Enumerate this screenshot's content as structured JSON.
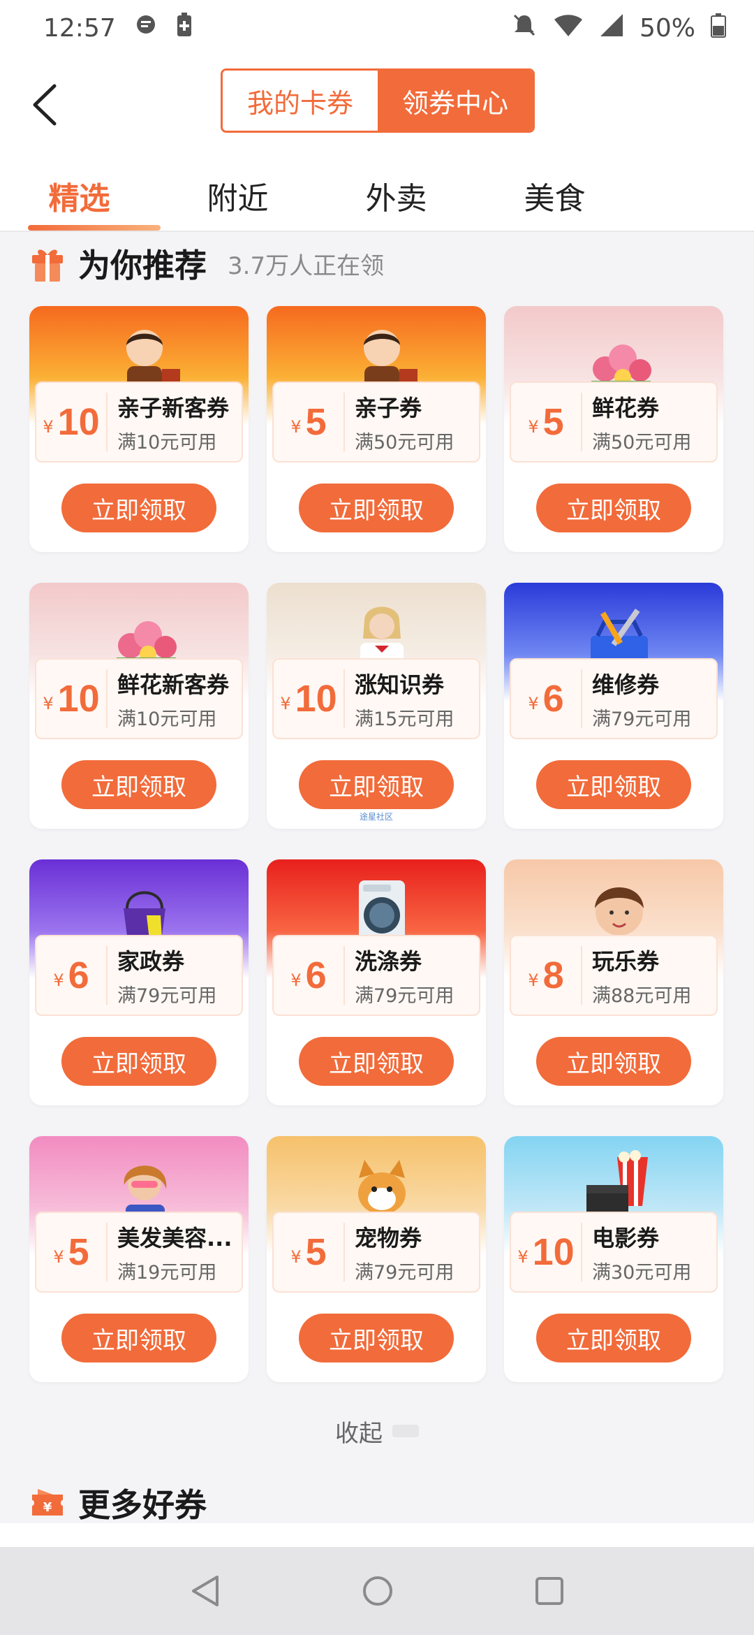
{
  "status_bar": {
    "time": "12:57",
    "battery": "50%"
  },
  "header": {
    "segments": [
      {
        "label": "我的卡券",
        "active": false
      },
      {
        "label": "领券中心",
        "active": true
      }
    ],
    "tabs": [
      {
        "label": "精选",
        "active": true
      },
      {
        "label": "附近",
        "active": false
      },
      {
        "label": "外卖",
        "active": false
      },
      {
        "label": "美食",
        "active": false
      }
    ]
  },
  "recommend": {
    "title": "为你推荐",
    "subtitle": "3.7万人正在领"
  },
  "coupons": [
    {
      "amount": "10",
      "name": "亲子新客券",
      "condition": "满10元可用",
      "button": "立即领取",
      "theme": "kids"
    },
    {
      "amount": "5",
      "name": "亲子券",
      "condition": "满50元可用",
      "button": "立即领取",
      "theme": "kids"
    },
    {
      "amount": "5",
      "name": "鲜花券",
      "condition": "满50元可用",
      "button": "立即领取",
      "theme": "flowers"
    },
    {
      "amount": "10",
      "name": "鲜花新客券",
      "condition": "满10元可用",
      "button": "立即领取",
      "theme": "flowers"
    },
    {
      "amount": "10",
      "name": "涨知识券",
      "condition": "满15元可用",
      "button": "立即领取",
      "theme": "study"
    },
    {
      "amount": "6",
      "name": "维修券",
      "condition": "满79元可用",
      "button": "立即领取",
      "theme": "repair"
    },
    {
      "amount": "6",
      "name": "家政券",
      "condition": "满79元可用",
      "button": "立即领取",
      "theme": "house"
    },
    {
      "amount": "6",
      "name": "洗涤券",
      "condition": "满79元可用",
      "button": "立即领取",
      "theme": "laundry"
    },
    {
      "amount": "8",
      "name": "玩乐券",
      "condition": "满88元可用",
      "button": "立即领取",
      "theme": "fun"
    },
    {
      "amount": "5",
      "name": "美发美容...",
      "condition": "满19元可用",
      "button": "立即领取",
      "theme": "beauty"
    },
    {
      "amount": "5",
      "name": "宠物券",
      "condition": "满79元可用",
      "button": "立即领取",
      "theme": "pet"
    },
    {
      "amount": "10",
      "name": "电影券",
      "condition": "满30元可用",
      "button": "立即领取",
      "theme": "movie"
    }
  ],
  "watermark": "途星社区",
  "collapse_label": "收起",
  "more": {
    "title": "更多好券"
  },
  "currency_symbol": "¥"
}
